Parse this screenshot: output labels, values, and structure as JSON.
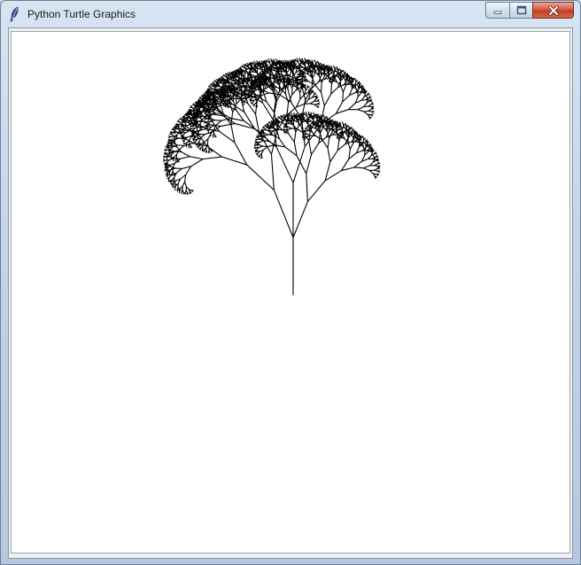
{
  "window": {
    "title": "Python Turtle Graphics",
    "icon": "feather-icon",
    "controls": {
      "minimize_icon": "minimize-icon",
      "maximize_icon": "maximize-icon",
      "close_icon": "close-icon"
    }
  },
  "canvas": {
    "background": "#ffffff",
    "pen_color": "#000000",
    "drawing": "fractal-tree"
  }
}
